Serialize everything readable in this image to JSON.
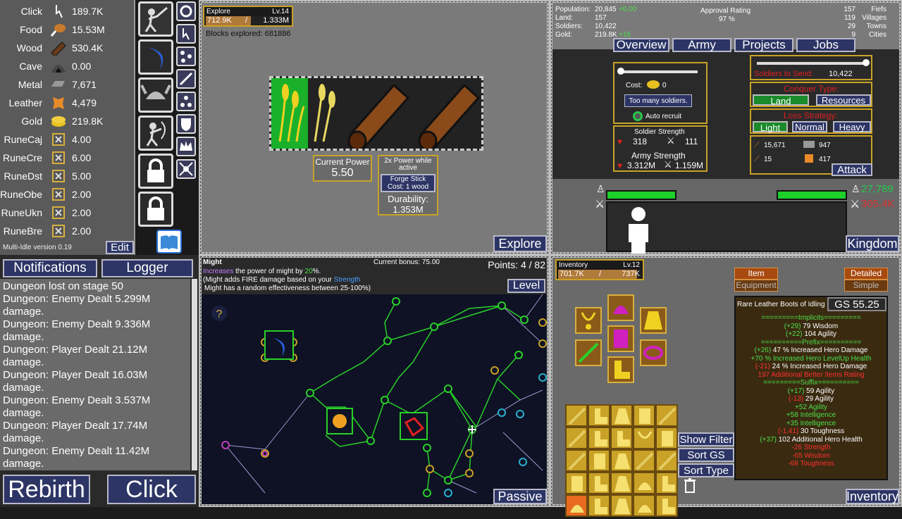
{
  "resources": [
    {
      "name": "Click",
      "value": "189.7K",
      "icon": "pointer-icon"
    },
    {
      "name": "Food",
      "value": "15.53M",
      "icon": "meat-icon"
    },
    {
      "name": "Wood",
      "value": "530.4K",
      "icon": "log-icon"
    },
    {
      "name": "Cave",
      "value": "0.00",
      "icon": "cave-icon"
    },
    {
      "name": "Metal",
      "value": "7,671",
      "icon": "metal-icon"
    },
    {
      "name": "Leather",
      "value": "4,479",
      "icon": "leather-icon"
    },
    {
      "name": "Gold",
      "value": "219.8K",
      "icon": "gold-icon"
    },
    {
      "name": "RuneCaj",
      "value": "4.00",
      "icon": "rune-icon"
    },
    {
      "name": "RuneCre",
      "value": "6.00",
      "icon": "rune-icon"
    },
    {
      "name": "RuneDst",
      "value": "5.00",
      "icon": "rune-icon"
    },
    {
      "name": "RuneObe",
      "value": "2.00",
      "icon": "rune-icon"
    },
    {
      "name": "RuneUkn",
      "value": "2.00",
      "icon": "rune-icon"
    },
    {
      "name": "RuneBre",
      "value": "2.00",
      "icon": "rune-icon"
    }
  ],
  "version": "Multi-Idle version 0.19",
  "edit_label": "Edit",
  "notifications_label": "Notifications",
  "logger_label": "Logger",
  "log": [
    "Dungeon lost on stage 50",
    "Dungeon: Enemy Dealt 5.299M damage.",
    "Dungeon: Enemy Dealt 9.336M damage.",
    "Dungeon: Player Dealt 21.12M damage.",
    "Dungeon: Player Dealt 16.03M damage.",
    "Dungeon: Enemy Dealt 3.537M damage.",
    "Dungeon: Player Dealt 17.74M damage.",
    "Dungeon: Enemy Dealt 11.42M damage."
  ],
  "rebirth_label": "Rebirth",
  "click_label": "Click",
  "explore": {
    "title": "Explore",
    "level": "Lv.14",
    "xp": "712.9K",
    "xp_sep": "/",
    "xp_max": "1.333M",
    "xp_fraction": 0.535,
    "blocks": "Blocks explored: 681886",
    "current_power_label": "Current Power",
    "current_power": "5.50",
    "power_note": "2x Power while active",
    "forge_label": "Forge Stick",
    "forge_cost": "Cost: 1 wood",
    "durability_label": "Durability:",
    "durability": "1.353M",
    "tab_label": "Explore"
  },
  "kingdom": {
    "stats_left": [
      {
        "label": "Population:",
        "value": "20,845",
        "delta": "+0.00"
      },
      {
        "label": "Land:",
        "value": "157",
        "delta": ""
      },
      {
        "label": "Soldiers:",
        "value": "10,422",
        "delta": ""
      },
      {
        "label": "Gold:",
        "value": "219.8K",
        "delta": "+16"
      }
    ],
    "approval_label": "Approval Rating",
    "approval": "97 %",
    "stats_right": [
      {
        "value": "157",
        "label": "Fiefs"
      },
      {
        "value": "119",
        "label": "Villages"
      },
      {
        "value": "29",
        "label": "Towns"
      },
      {
        "value": "9",
        "label": "Cities"
      }
    ],
    "tabs": [
      "Overview",
      "Army",
      "Projects",
      "Jobs"
    ],
    "cost_label": "Cost:",
    "cost_value": "0",
    "too_many": "Too many soldiers.",
    "auto_recruit": "Auto recruit",
    "soldier_strength_label": "Soldier Strength",
    "soldier_hp": "318",
    "soldier_atk": "111",
    "army_strength_label": "Army Strength",
    "army_hp": "3.312M",
    "army_atk": "1.159M",
    "soldiers_to_send_label": "Soldiers to Send:",
    "soldiers_to_send": "10,422",
    "conquer_type_label": "Conquer Type:",
    "conquer_land": "Land",
    "conquer_resources": "Resources",
    "loss_strategy_label": "Loss Strategy:",
    "loss_light": "Light",
    "loss_normal": "Normal",
    "loss_heavy": "Heavy",
    "loot": [
      "15,671",
      "947",
      "15",
      "417"
    ],
    "attack_label": "Attack",
    "enemy_count": "27,789",
    "enemy_power": "305.4K",
    "tab_label": "Kingdom",
    "accent_green": "#26c94a",
    "accent_red": "#d93030"
  },
  "passive": {
    "title": "Might",
    "desc_1_a": "Increases",
    "desc_1_b": " the power of might by ",
    "desc_1_c": "20",
    "desc_1_d": "%.",
    "desc_2_a": "(Might adds FIRE damage based on your ",
    "desc_2_b": "Strength",
    "desc_3": "Might has a random effectiveness between 25-100%)",
    "current_bonus": "Current bonus: 75.00",
    "points": "Points: 4 / 82",
    "level_label": "Level",
    "help": "?",
    "tab_label": "Passive"
  },
  "inventory": {
    "title": "Inventory",
    "level": "Lv.12",
    "xp": "701.7K",
    "xp_sep": "/",
    "xp_max": "737K",
    "xp_fraction": 0.952,
    "item_label": "Item",
    "equipment_label": "Equipment",
    "detailed_label": "Detailed",
    "simple_label": "Simple",
    "item_name": "Rare Leather Boots of Idling",
    "gs": "GS 55.25",
    "tooltip": [
      {
        "text": "=========Implicits=========",
        "color": "#4ce04c"
      },
      {
        "text": "(+29) 79 Wisdom",
        "color": "#ffffff",
        "hl": "(+29)",
        "hlc": "#4ce04c"
      },
      {
        "text": "(+22) 104 Agility",
        "color": "#ffffff",
        "hl": "(+22)",
        "hlc": "#4ce04c"
      },
      {
        "text": "==========Prefix==========",
        "color": "#4ce04c"
      },
      {
        "text": "(+26) 47 % Increased Hero Damage",
        "color": "#ffffff",
        "hl": "(+26)",
        "hlc": "#4ce04c"
      },
      {
        "text": "+70 % Increased Hero LevelUp Health",
        "color": "#4ce04c"
      },
      {
        "text": "(-21) 24 % Increased Hero Damage",
        "color": "#ffffff",
        "hl": "(-21)",
        "hlc": "#ff3030"
      },
      {
        "text": "197 Additional Better Items Rating",
        "color": "#ff3030"
      },
      {
        "text": "=========Suffix==========",
        "color": "#4ce04c"
      },
      {
        "text": "(+17) 59 Agility",
        "color": "#ffffff",
        "hl": "(+17)",
        "hlc": "#4ce04c"
      },
      {
        "text": "(-13) 29 Agility",
        "color": "#ffffff",
        "hl": "(-13)",
        "hlc": "#ff3030"
      },
      {
        "text": "+52 Agility",
        "color": "#4ce04c"
      },
      {
        "text": "+58 Intelligence",
        "color": "#4ce04c"
      },
      {
        "text": "+35 Intelligence",
        "color": "#4ce04c"
      },
      {
        "text": "(-1.41) 30 Toughness",
        "color": "#ffffff",
        "hl": "(-1.41)",
        "hlc": "#ff3030"
      },
      {
        "text": "(+37) 102 Additional Hero Health",
        "color": "#ffffff",
        "hl": "(+37)",
        "hlc": "#4ce04c"
      },
      {
        "text": "-26 Strength",
        "color": "#ff3030"
      },
      {
        "text": "-65 Wisdom",
        "color": "#ff3030"
      },
      {
        "text": "-68 Toughness",
        "color": "#ff3030"
      }
    ],
    "show_filter": "Show Filter",
    "sort_gs": "Sort GS",
    "sort_type": "Sort Type",
    "tab_label": "Inventory"
  }
}
